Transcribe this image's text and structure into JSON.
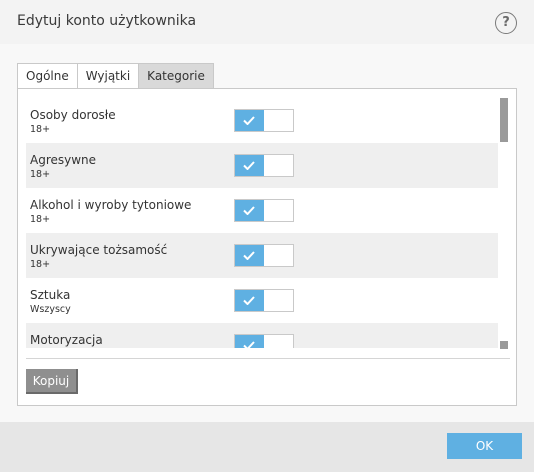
{
  "window": {
    "title": "Edytuj konto użytkownika",
    "help_label": "?"
  },
  "tabs": [
    {
      "label": "Ogólne",
      "active": false
    },
    {
      "label": "Wyjątki",
      "active": false
    },
    {
      "label": "Kategorie",
      "active": true
    }
  ],
  "categories": [
    {
      "name": "Osoby dorosłe",
      "age": "18+",
      "enabled": true
    },
    {
      "name": "Agresywne",
      "age": "18+",
      "enabled": true
    },
    {
      "name": "Alkohol i wyroby tytoniowe",
      "age": "18+",
      "enabled": true
    },
    {
      "name": "Ukrywające tożsamość",
      "age": "18+",
      "enabled": true
    },
    {
      "name": "Sztuka",
      "age": "Wszyscy",
      "enabled": true
    },
    {
      "name": "Motoryzacja",
      "age": "",
      "enabled": true
    }
  ],
  "buttons": {
    "copy_label": "Kopiuj",
    "ok_label": "OK"
  },
  "colors": {
    "accent": "#5fb0e2",
    "button_gray": "#8f8f8f"
  },
  "icons": {
    "toggle_on": "check-icon",
    "help": "question-icon"
  }
}
